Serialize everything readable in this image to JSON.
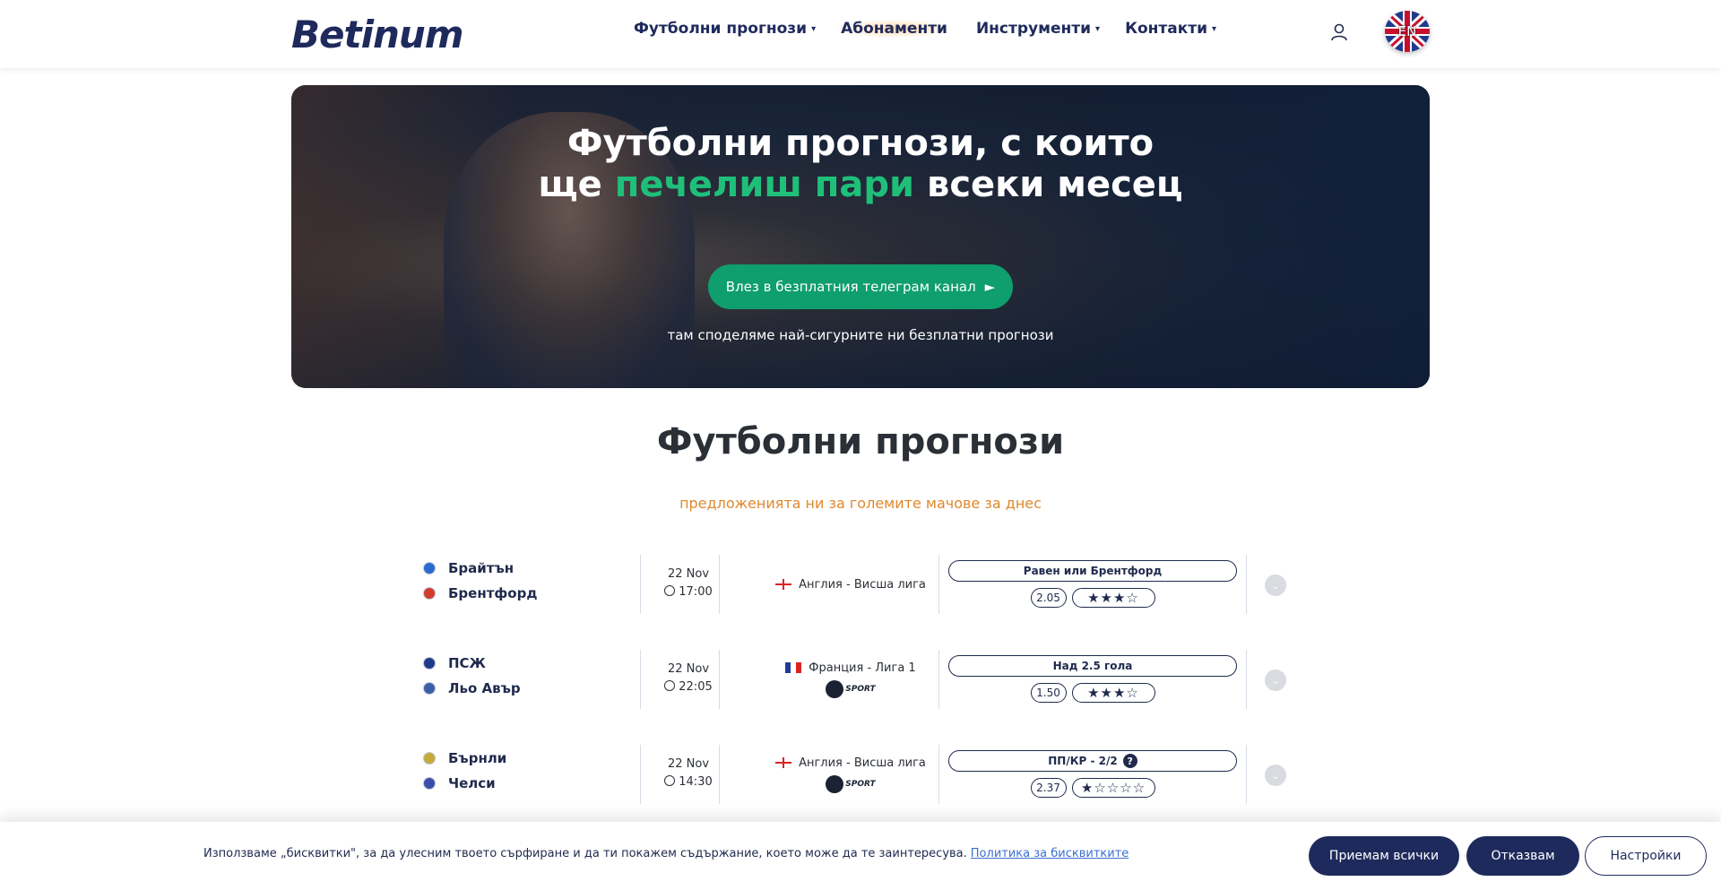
{
  "header": {
    "logo": "Betinum",
    "nav": [
      {
        "label": "Футболни прогнози",
        "caret": "▾"
      },
      {
        "label": "Абонаменти",
        "caret": ""
      },
      {
        "label": "Инструменти",
        "caret": "▾"
      },
      {
        "label": "Контакти",
        "caret": "▾"
      }
    ],
    "lang": "EN"
  },
  "hero": {
    "title_line1": "Футболни прогнози, с които",
    "title_line2_pre": "ще ",
    "title_line2_green": "печелиш пари",
    "title_line2_post": " всеки месец",
    "button": "Влез в безплатния телеграм канал",
    "button_icon": "►",
    "subtitle": "там споделяме най-сигурните ни безплатни прогнози"
  },
  "section": {
    "title": "Футболни прогнози",
    "subtitle": "предложенията ни за големите мачове за днес"
  },
  "matches": [
    {
      "home": "Брайтън",
      "away": "Брентфорд",
      "date": "22 Nov",
      "time": "17:00",
      "league": "Англия - Висша лига",
      "flag": "england",
      "tv": "",
      "tip": "Равен или Брентфорд",
      "help": "",
      "odds": "2.05",
      "stars": "★★★☆",
      "rating": 3,
      "rating_max": 4
    },
    {
      "home": "ПСЖ",
      "away": "Льо Авър",
      "date": "22 Nov",
      "time": "22:05",
      "league": "Франция - Лига 1",
      "flag": "france",
      "tv": "SPORT",
      "tip": "Над 2.5 гола",
      "help": "",
      "odds": "1.50",
      "stars": "★★★☆",
      "rating": 3,
      "rating_max": 4
    },
    {
      "home": "Бърнли",
      "away": "Челси",
      "date": "22 Nov",
      "time": "14:30",
      "league": "Англия - Висша лига",
      "flag": "england",
      "tv": "SPORT",
      "tip": "ПП/КР - 2/2",
      "help": "?",
      "odds": "2.37",
      "stars": "★☆☆☆☆",
      "rating": 1,
      "rating_max": 5
    }
  ],
  "cookie": {
    "text": "Използваме „бисквитки\", за да улесним твоето сърфиране и да ти покажем съдържание, което може да те заинтересува.",
    "link": "Политика за бисквитките",
    "accept": "Приемам всички",
    "reject": "Отказвам",
    "settings": "Настройки"
  }
}
